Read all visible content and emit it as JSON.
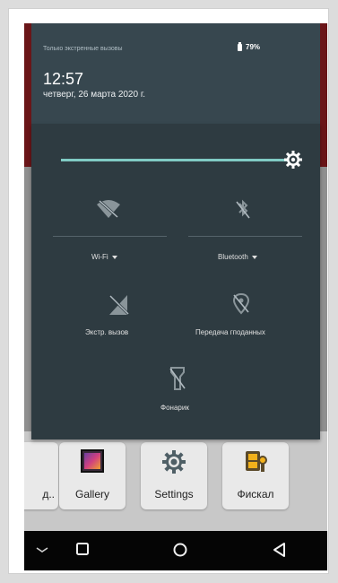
{
  "header": {
    "status_text": "Только экстренные вызовы",
    "battery_text": "79%",
    "time": "12:57",
    "date": "четверг, 26 марта 2020 г."
  },
  "brightness": {
    "level": 0.98,
    "icon": "brightness-gear-icon"
  },
  "quick_settings": {
    "wifi": {
      "label": "Wi-Fi",
      "icon": "wifi-off-icon"
    },
    "bluetooth": {
      "label": "Bluetooth",
      "icon": "bluetooth-off-icon"
    },
    "emergency_call": {
      "label": "Экстр. вызов",
      "icon": "no-signal-icon"
    },
    "data_transfer": {
      "label": "Передача гподанных",
      "icon": "location-off-icon"
    },
    "flashlight": {
      "label": "Фонарик",
      "icon": "flashlight-off-icon"
    }
  },
  "home_apps": [
    {
      "label": "д..",
      "icon": "app-icon"
    },
    {
      "label": "Gallery",
      "icon": "gallery-icon"
    },
    {
      "label": "Settings",
      "icon": "settings-gear-icon"
    },
    {
      "label": "Фискал",
      "icon": "fiscal-icon"
    }
  ],
  "navbar": {
    "icons": [
      "chevron-down-icon",
      "recents-icon",
      "home-icon",
      "back-icon"
    ]
  },
  "colors": {
    "panel": "#2e3b41",
    "header": "#37474f",
    "accent": "#80cbc4",
    "red_bar": "#6a1518"
  }
}
